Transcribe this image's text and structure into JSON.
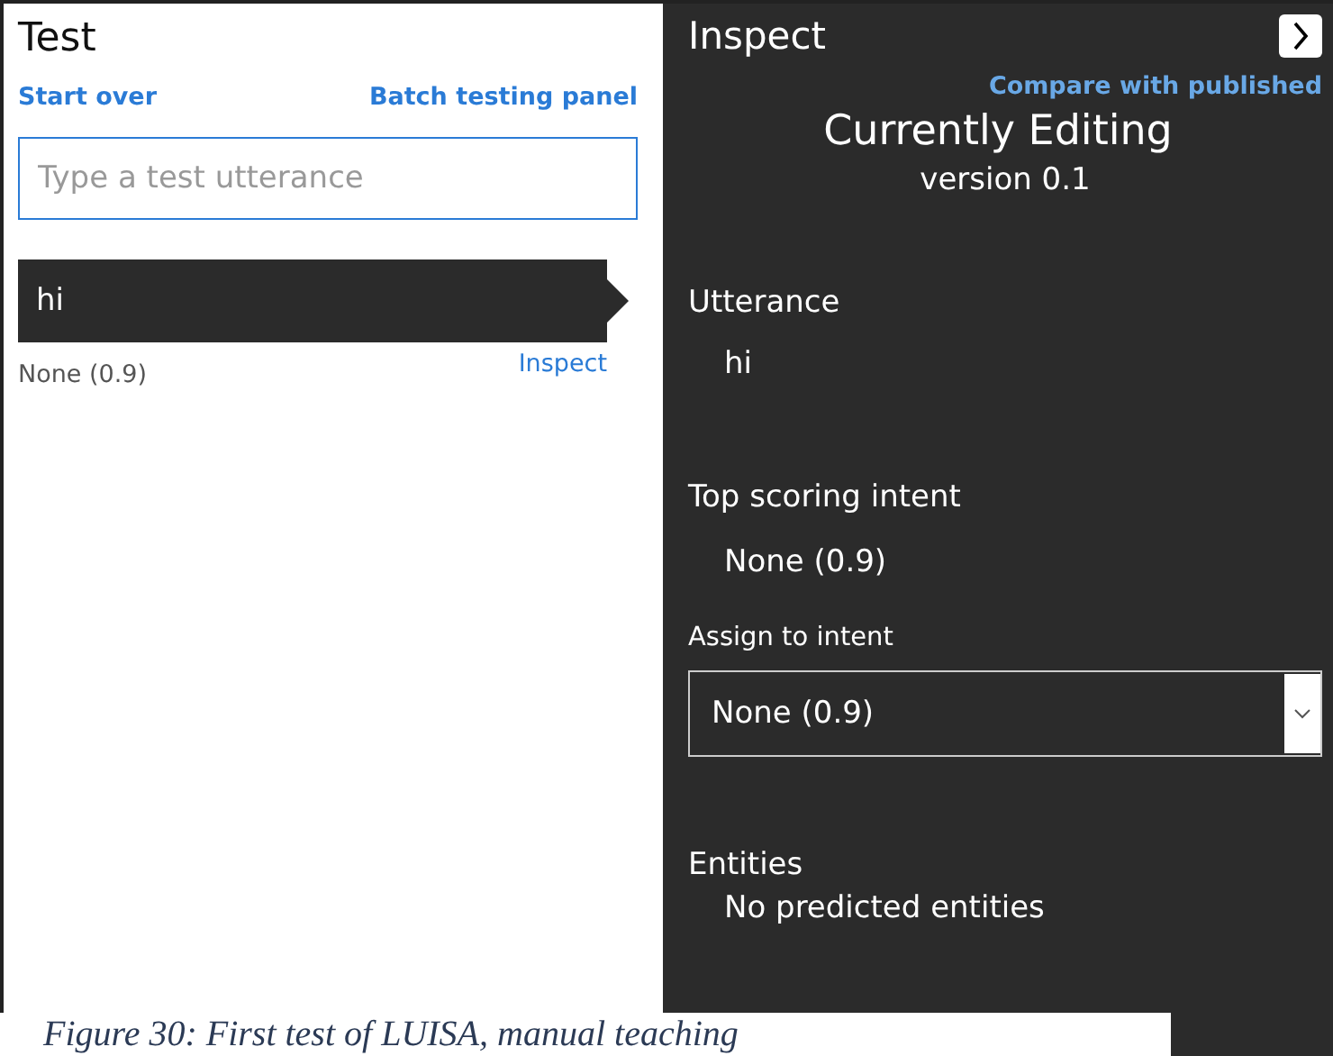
{
  "test_panel": {
    "title": "Test",
    "links": [
      "Start over",
      "Batch testing panel"
    ],
    "input": {
      "placeholder": "Type a test utterance"
    },
    "results": [
      {
        "utterance": "hi",
        "intent": "None (0.9)",
        "action": "Inspect",
        "selected": true
      }
    ]
  },
  "inspect_panel": {
    "title": "Inspect",
    "compare_link": "Compare with published",
    "status": "Currently Editing",
    "version": "version 0.1",
    "utterance_label": "Utterance",
    "utterance": "hi",
    "top_intent_label": "Top scoring intent",
    "top_intent": "None (0.9)",
    "assign_label": "Assign to intent",
    "assign_value": "None (0.9)",
    "entities_label": "Entities",
    "entities": "No predicted entities"
  },
  "caption": "Figure 30: First test of LUISA, manual teaching"
}
